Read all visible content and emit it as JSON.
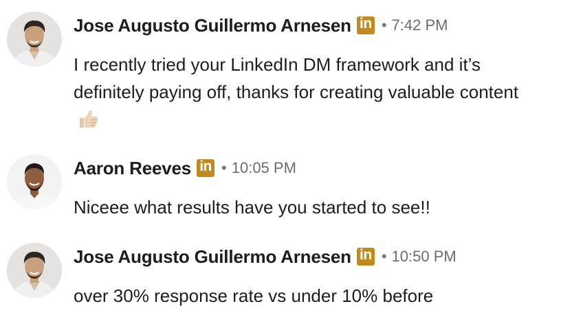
{
  "colors": {
    "linkedin_badge": "#c08a1e",
    "name_text": "#1d1d1f",
    "timestamp_text": "#6c6c70"
  },
  "messages": [
    {
      "sender": "Jose Augusto Guillermo Arnesen",
      "badge": "in",
      "separator": "•",
      "time": "7:42 PM",
      "text": "I recently tried your LinkedIn DM framework and it’s definitely paying off, thanks for creating valuable content",
      "emoji": "thumbs-up-icon"
    },
    {
      "sender": "Aaron Reeves",
      "badge": "in",
      "separator": "•",
      "time": "10:05 PM",
      "text": "Niceee what results have you started to see!!"
    },
    {
      "sender": "Jose Augusto Guillermo Arnesen",
      "badge": "in",
      "separator": "•",
      "time": "10:50 PM",
      "text": "over 30% response rate vs under 10% before"
    }
  ]
}
